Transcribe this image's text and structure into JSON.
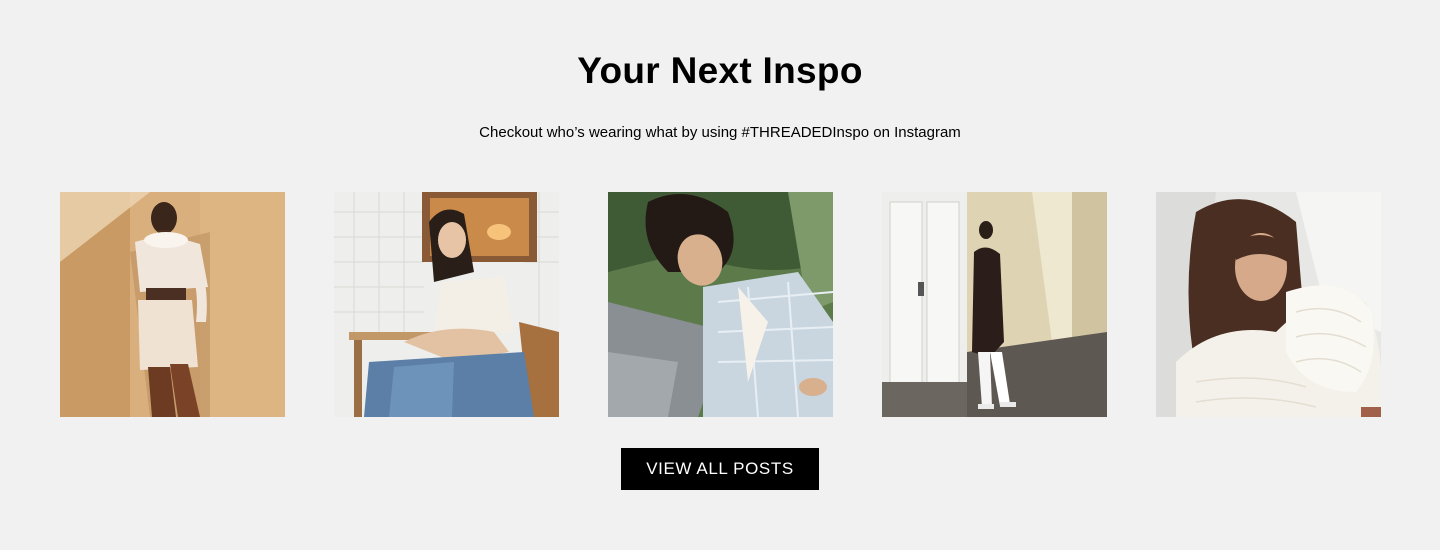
{
  "section": {
    "title": "Your Next Inspo",
    "subtitle": "Checkout who’s wearing what by using #THREADEDInspo on Instagram",
    "button_label": "VIEW ALL POSTS"
  },
  "posts": [
    {
      "alt": "Woman in cream knit cardigan set against beige wall"
    },
    {
      "alt": "Woman in white satin cami and jeans seated in tiled cafe"
    },
    {
      "alt": "Woman with curly hair in pastel plaid blazer reclining"
    },
    {
      "alt": "Woman in black bodycon dress and white boots by doorway"
    },
    {
      "alt": "Woman with long brown hair in white textured puff-sleeve top"
    }
  ]
}
